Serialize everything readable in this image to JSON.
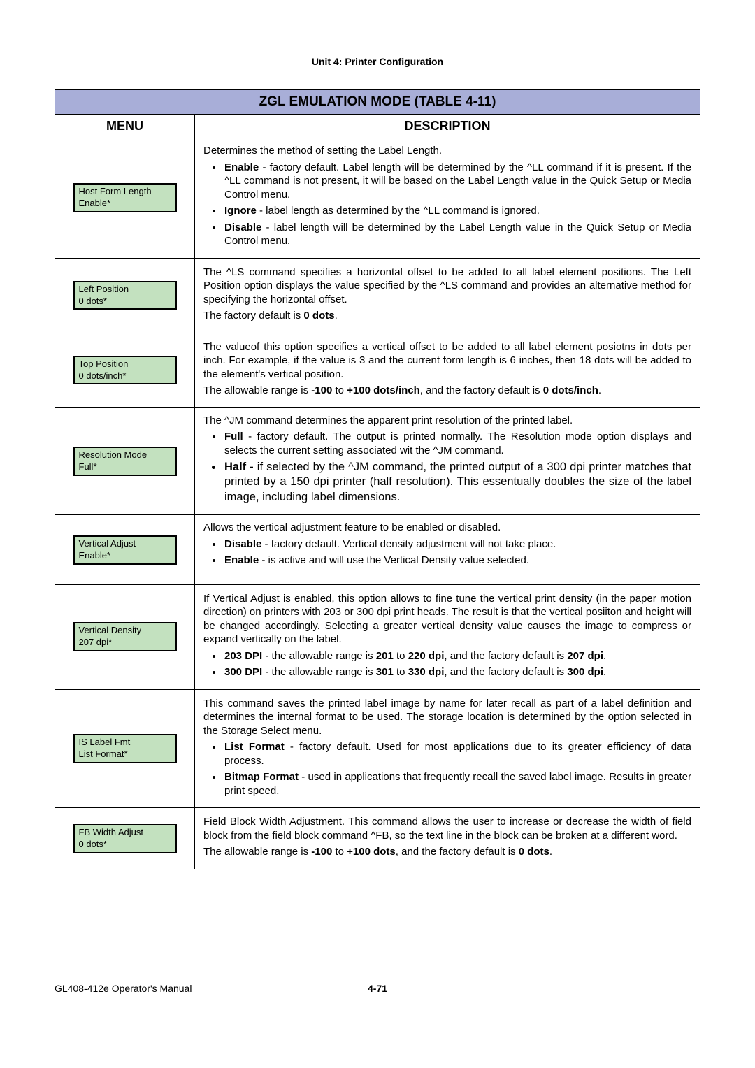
{
  "header": {
    "unit": "Unit 4:  Printer Configuration"
  },
  "table": {
    "title": "ZGL EMULATION MODE (TABLE 4-11)",
    "cols": {
      "menu": "MENU",
      "description": "DESCRIPTION"
    }
  },
  "rows": {
    "hostFormLength": {
      "menu": {
        "line1": "Host Form Length",
        "line2": "Enable*"
      },
      "intro": "Determines the method of setting the Label Length.",
      "items": [
        {
          "label": "Enable",
          "text": " - factory default. Label length will be determined by the ^LL command if it is present. If the ^LL command is not present, it will be based on the Label Length value in the Quick Setup or Media Control menu."
        },
        {
          "label": "Ignore",
          "text": " - label length as determined by the ^LL command is ignored."
        },
        {
          "label": "Disable",
          "text": " - label length will be determined by the Label Length value in the Quick Setup or Media Control menu."
        }
      ]
    },
    "leftPosition": {
      "menu": {
        "line1": "Left Position",
        "line2": "0  dots*"
      },
      "p1": "The ^LS command specifies a horizontal offset to be added to all label element positions. The Left Position option displays the value specified by the ^LS command and provides an alternative method for specifying the horizontal offset.",
      "p2a": "The factory default is ",
      "p2b": "0 dots",
      "p2c": "."
    },
    "topPosition": {
      "menu": {
        "line1": "Top Position",
        "line2": "0  dots/inch*"
      },
      "p1": "The valueof this option specifies a vertical offset to be added to all label element posiotns in dots per inch. For example, if the value is 3 and the current form length is 6 inches, then 18 dots will be added to the element's vertical position.",
      "p2_pre": "The allowable range is ",
      "p2_r1": "-100",
      "p2_mid1": " to ",
      "p2_r2": "+100 dots/inch",
      "p2_mid2": ", and the factory default is ",
      "p2_def": "0 dots/inch",
      "p2_post": "."
    },
    "resolutionMode": {
      "menu": {
        "line1": "Resolution Mode",
        "line2": "Full*"
      },
      "intro": "The ^JM command determines the apparent print resolution of the printed label.",
      "items": [
        {
          "label": "Full",
          "text": " - factory default. The output is printed normally. The Resolution mode option displays and selects the current setting associated wit the ^JM command."
        },
        {
          "label": "Half",
          "text": " - if selected by the ^JM command, the printed output of a 300 dpi printer matches that printed by a 150 dpi printer (half resolution). This essentually doubles the size of the label image, including label dimensions."
        }
      ]
    },
    "verticalAdjust": {
      "menu": {
        "line1": "Vertical Adjust",
        "line2": "Enable*"
      },
      "intro": "Allows the vertical adjustment feature to be enabled or disabled.",
      "items": [
        {
          "label": "Disable",
          "text": " - factory default. Vertical density adjustment will not take place."
        },
        {
          "label": "Enable",
          "text": " - is active and will use the Vertical Density value selected."
        }
      ]
    },
    "verticalDensity": {
      "menu": {
        "line1": "Vertical Density",
        "line2": "207  dpi*"
      },
      "p1": "If Vertical Adjust is enabled, this option allows to fine tune the vertical print density (in the paper motion direction) on printers with 203 or 300 dpi print heads. The result is that the vertical posiiton and height will be changed accordingly. Selecting a greater vertical density value causes the image to compress or expand vertically on the label.",
      "items": [
        {
          "label": "203 DPI",
          "pre": " - the allowable range is ",
          "r1": "201",
          "mid1": " to ",
          "r2": "220 dpi",
          "mid2": ", and the factory default is ",
          "def": "207 dpi",
          "post": "."
        },
        {
          "label": "300 DPI",
          "pre": " - the allowable range is ",
          "r1": "301",
          "mid1": " to ",
          "r2": "330 dpi",
          "mid2": ", and the factory default is ",
          "def": "300 dpi",
          "post": "."
        }
      ]
    },
    "isLabelFmt": {
      "menu": {
        "line1": "IS Label Fmt",
        "line2": "List Format*"
      },
      "p1": "This command saves the printed label image by name for later recall as part of a label definition and determines the internal format to be used. The storage location is determined by the option selected in the Storage Select menu.",
      "items": [
        {
          "label": "List Format",
          "text": " - factory default. Used for most applications due to its greater efficiency of data process."
        },
        {
          "label": "Bitmap Format",
          "text": " - used in applications that frequently recall the saved label image. Results in greater print speed."
        }
      ]
    },
    "fbWidthAdjust": {
      "menu": {
        "line1": "FB Width Adjust",
        "line2": "0  dots*"
      },
      "p1": "Field Block Width Adjustment. This command allows the user to increase or decrease the width of field block from the field block command ^FB, so the text line in the block can be broken at a different word.",
      "p2_pre": "The allowable range is ",
      "p2_r1": "-100",
      "p2_mid1": " to ",
      "p2_r2": "+100 dots",
      "p2_mid2": ", and the factory default is ",
      "p2_def": "0 dots",
      "p2_post": "."
    }
  },
  "footer": {
    "left": "GL408-412e Operator's Manual",
    "center": "4-71"
  }
}
